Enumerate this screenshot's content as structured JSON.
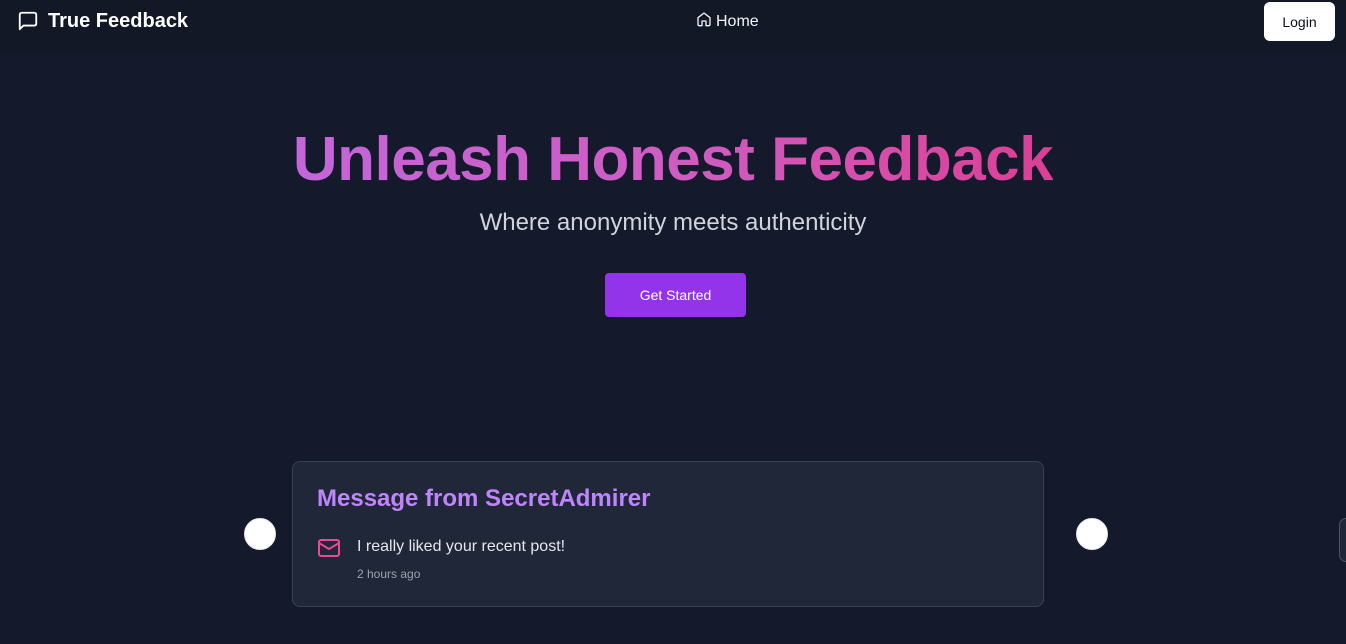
{
  "navbar": {
    "brand": {
      "icon": "message-square-icon",
      "label": "True Feedback"
    },
    "home": {
      "icon": "home-icon",
      "label": "Home"
    },
    "login_label": "Login"
  },
  "hero": {
    "title": "Unleash Honest Feedback",
    "subtitle": "Where anonymity meets authenticity",
    "cta_label": "Get Started"
  },
  "carousel": {
    "current": {
      "title": "Message from SecretAdmirer",
      "icon": "mail-icon",
      "content": "I really liked your recent post!",
      "received": "2 hours ago"
    }
  },
  "colors": {
    "background": "#141a2b",
    "accent": "#9333ea",
    "title_gradient": [
      "#c366da",
      "#db3f95"
    ],
    "card_title": "#c084fc",
    "mail_icon": "#ec4899"
  }
}
